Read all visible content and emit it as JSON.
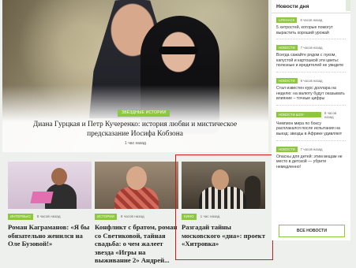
{
  "hero": {
    "tag": "ЗВЁЗДНЫЕ ИСТОРИИ",
    "title": "Диана Гурцкая и Петр Кучеренко: история любви и мистическое предсказание Иосифа Кобзона",
    "time": "1 час назад"
  },
  "cards": [
    {
      "badge": "ИНТЕРВЬЮ",
      "time": "8 часов назад",
      "title": "Роман Каграманов: «Я бы обязательно женился на Оле Бузовой!»"
    },
    {
      "badge": "ИСТОРИИ",
      "time": "8 часов назад",
      "title": "Конфликт с братом, роман со Светиковой, тайная свадьба: о чем жалеет звезда «Игры на выживание 2» Андрей..."
    },
    {
      "badge": "КИНО",
      "time": "1 час назад",
      "title": "Разгадай тайны московского «дна»: проект «Хитровка»"
    }
  ],
  "sidebar": {
    "title": "Новости дня",
    "items": [
      {
        "badge": "LIFEHACK",
        "time": "6 часов назад",
        "text": "5 хитростей, которые помогут вырастить хороший урожай"
      },
      {
        "badge": "НОВОСТИ",
        "time": "7 часов назад",
        "text": "Всегда сажайте рядом с луком, капустой и картошкой эти цветы: полезные и вредителей не увидите"
      },
      {
        "badge": "НОВОСТИ",
        "time": "8 часов назад",
        "text": "Стал известен курс доллара на неделю: на валюту будут оказывать влияние – точные цифры"
      },
      {
        "badge": "НОВОСТИ ШОУ-БИЗНЕСА",
        "time": "8 часов назад",
        "text": "Чемпион мира по боксу расплакался после испытания на выезд: звезды в Африке удивляют"
      },
      {
        "badge": "НОВОСТИ",
        "time": "7 часов назад",
        "text": "Опасны для детей: этим вещам не место в детской — убрите немедленно!"
      }
    ],
    "all_news": "ВСЕ НОВОСТИ"
  },
  "colors": {
    "accent": "#8dc63f",
    "highlight": "#d51a1a"
  }
}
